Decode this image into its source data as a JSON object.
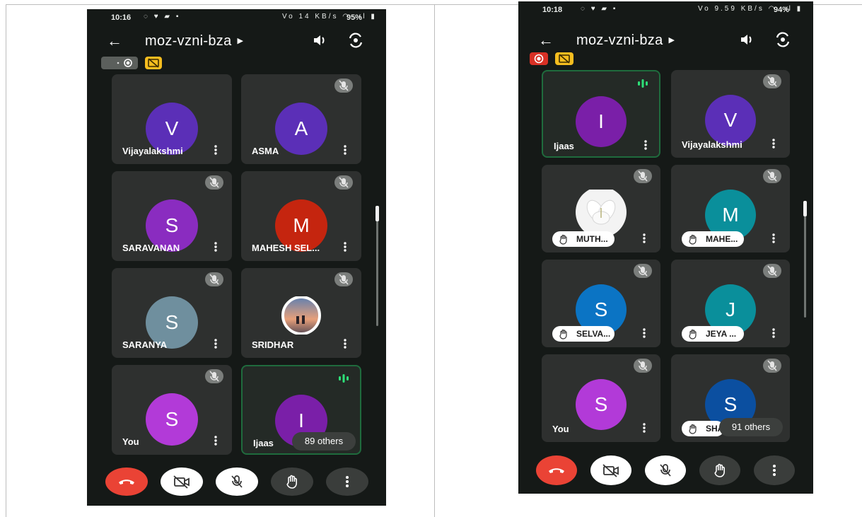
{
  "colors": {
    "end_call": "#ea4335",
    "tile_bg": "#2e302f",
    "active_border": "#1f6b3d",
    "speaking_green": "#2ee078",
    "record_red": "#d93025",
    "caption_yellow": "#f5bd1f"
  },
  "left_phone": {
    "status": {
      "time": "10:16",
      "left_icons": "◌ ♥ ▰ ▪",
      "right_icons": "Vo 14 KB/s ◠ .ıl ▮",
      "battery": "95%"
    },
    "meeting_code": "moz-vzni-bza",
    "tiles": [
      {
        "initial": "V",
        "color": "#5b2fb7",
        "name": "Vijayalakshmi",
        "muted": false,
        "speaking": false
      },
      {
        "initial": "A",
        "color": "#5b2fb7",
        "name": "ASMA",
        "muted": true,
        "speaking": false
      },
      {
        "initial": "S",
        "color": "#8a2cc0",
        "name": "SARAVANAN",
        "muted": true,
        "speaking": false
      },
      {
        "initial": "M",
        "color": "#c5250f",
        "name": "MAHESH SEL...",
        "muted": true,
        "speaking": false
      },
      {
        "initial": "S",
        "color": "#6f8f9e",
        "name": "SARANYA",
        "muted": true,
        "speaking": false
      },
      {
        "initial": "",
        "color": "#8a6e74",
        "name": "SRIDHAR",
        "muted": true,
        "speaking": false,
        "photo": "sunset-photo"
      },
      {
        "initial": "S",
        "color": "#b23ad8",
        "name": "You",
        "muted": true,
        "speaking": false
      },
      {
        "initial": "I",
        "color": "#7a1fa8",
        "name": "Ijaas",
        "muted": false,
        "speaking": true,
        "others": "89 others"
      }
    ]
  },
  "right_phone": {
    "status": {
      "time": "10:18",
      "left_icons": "◌ ♥ ▰ ▪",
      "right_icons": "Vo 9.59 KB/s ◠ .ıl ▮",
      "battery": "94%"
    },
    "meeting_code": "moz-vzni-bza",
    "tiles": [
      {
        "initial": "I",
        "color": "#7a1fa8",
        "name": "Ijaas",
        "muted": false,
        "speaking": true
      },
      {
        "initial": "V",
        "color": "#5b2fb7",
        "name": "Vijayalakshmi",
        "muted": true,
        "speaking": false
      },
      {
        "initial": "",
        "color": "#e6e6e6",
        "name": "MUTH...",
        "muted": true,
        "hand": true,
        "photo": "flower-photo"
      },
      {
        "initial": "M",
        "color": "#0a8f9b",
        "name": "MAHE...",
        "muted": true,
        "hand": true
      },
      {
        "initial": "S",
        "color": "#0b74c4",
        "name": "SELVA...",
        "muted": true,
        "hand": true
      },
      {
        "initial": "J",
        "color": "#0a8f9b",
        "name": "JEYA ...",
        "muted": true,
        "hand": true
      },
      {
        "initial": "S",
        "color": "#b23ad8",
        "name": "You",
        "muted": true,
        "hand": false
      },
      {
        "initial": "S",
        "color": "#0b4fa0",
        "name": "SHA",
        "muted": true,
        "hand": true,
        "others": "91 others"
      }
    ]
  },
  "controls": [
    "end-call",
    "camera-off",
    "mic-off",
    "raise-hand",
    "more-options"
  ]
}
